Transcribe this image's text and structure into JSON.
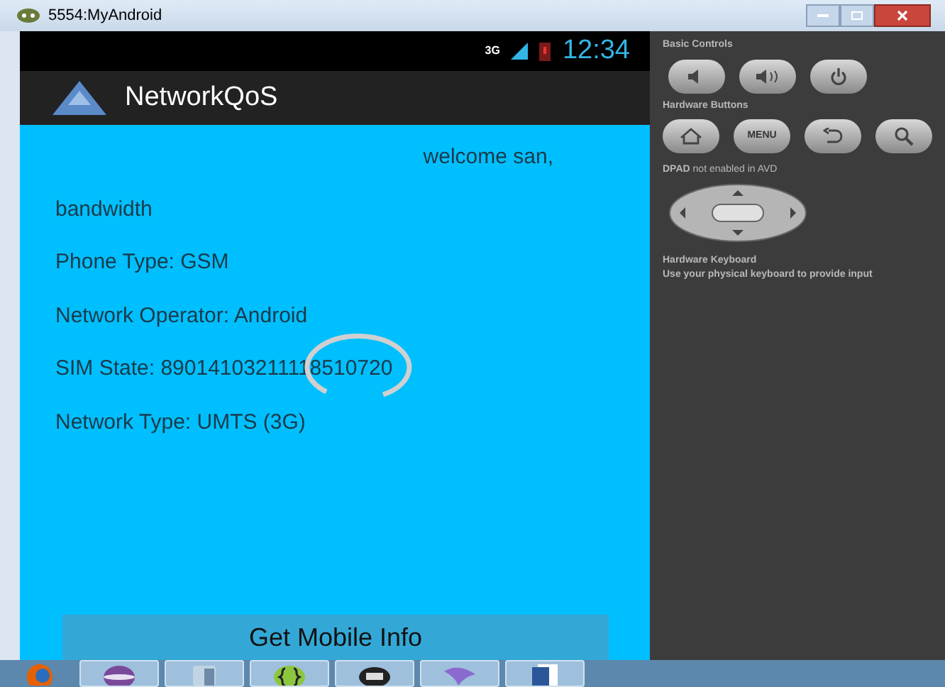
{
  "window": {
    "title": "5554:MyAndroid"
  },
  "status_bar": {
    "network": "3G",
    "time": "12:34"
  },
  "action_bar": {
    "title": "NetworkQoS"
  },
  "content": {
    "welcome": "welcome san,",
    "lines": [
      "bandwidth",
      "Phone Type: GSM",
      "Network Operator: Android",
      "SIM State: 89014103211118510720",
      "Network Type: UMTS (3G)"
    ],
    "button": "Get Mobile Info"
  },
  "controls": {
    "basic_title": "Basic Controls",
    "hardware_title": "Hardware Buttons",
    "menu_label": "MENU",
    "dpad_bold": "DPAD",
    "dpad_note": "not enabled in AVD",
    "keyboard_title": "Hardware Keyboard",
    "keyboard_note": "Use your physical keyboard to provide input"
  },
  "taskbar": {
    "items": [
      {
        "kind": "browser"
      },
      {
        "kind": "sphere"
      },
      {
        "kind": "cube"
      },
      {
        "kind": "braces"
      },
      {
        "kind": "android"
      },
      {
        "kind": "dolphin"
      },
      {
        "kind": "document"
      }
    ]
  }
}
